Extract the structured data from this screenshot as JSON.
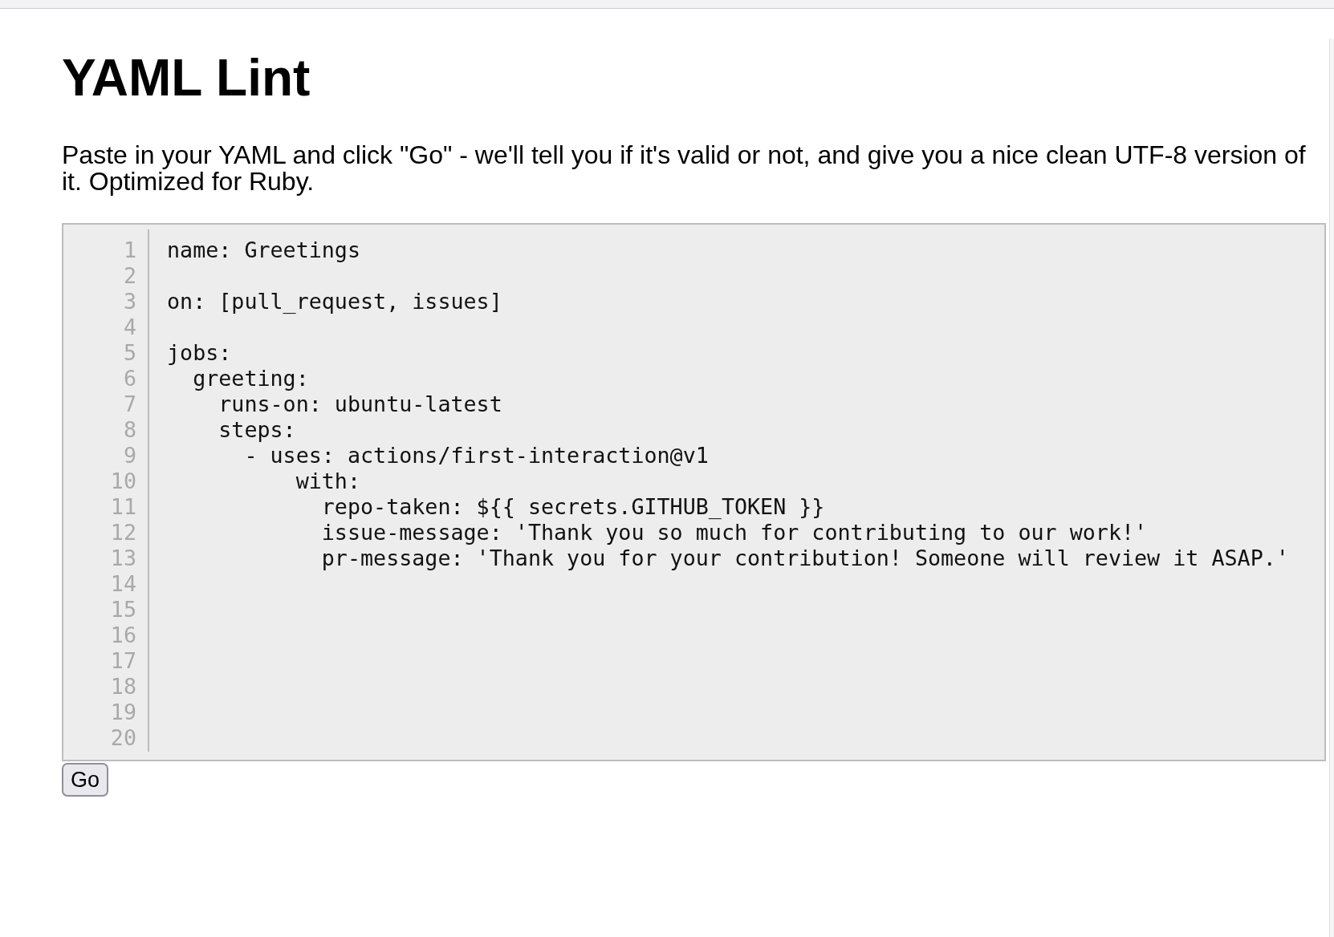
{
  "page": {
    "title": "YAML Lint",
    "intro": "Paste in your YAML and click \"Go\" - we'll tell you if it's valid or not, and give you a nice clean UTF-8 version of it. Optimized for Ruby."
  },
  "editor": {
    "lines": [
      {
        "number": "1",
        "code": "name: Greetings"
      },
      {
        "number": "2"
      },
      {
        "number": "3",
        "code": "on: [pull_request, issues]"
      },
      {
        "number": "4"
      },
      {
        "number": "5",
        "code": "jobs:"
      },
      {
        "number": "6",
        "code": "  greeting:"
      },
      {
        "number": "7",
        "code": "    runs-on: ubuntu-latest"
      },
      {
        "number": "8",
        "code": "    steps:"
      },
      {
        "number": "9",
        "code": "      - uses: actions/first-interaction@v1"
      },
      {
        "number": "10",
        "code": "          with:"
      },
      {
        "number": "11",
        "code": "            repo-taken: ${{ secrets.GITHUB_TOKEN }}"
      },
      {
        "number": "12",
        "code": "            issue-message: 'Thank you so much for contributing to our work!'"
      },
      {
        "number": "13",
        "code": "            pr-message: 'Thank you for your contribution! Someone will review it ASAP.'"
      },
      {
        "number": "14"
      },
      {
        "number": "15"
      },
      {
        "number": "16"
      },
      {
        "number": "17"
      },
      {
        "number": "18"
      },
      {
        "number": "19"
      },
      {
        "number": "20"
      }
    ]
  },
  "go_button": {
    "label": "Go"
  }
}
